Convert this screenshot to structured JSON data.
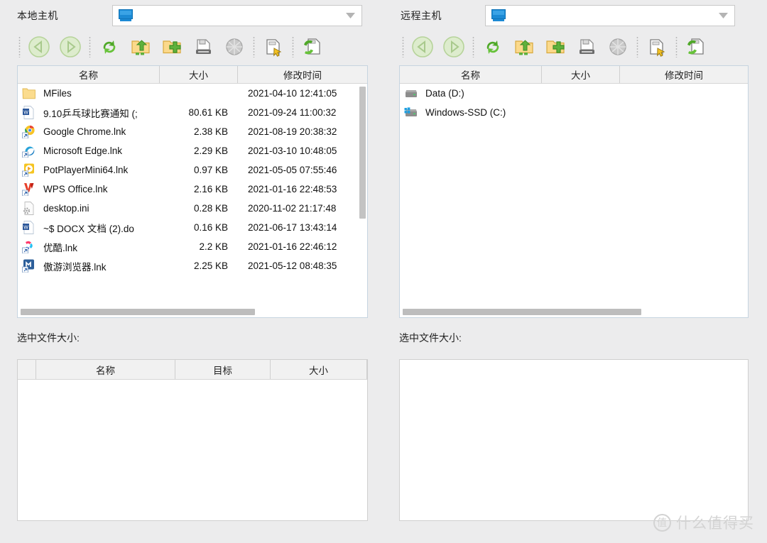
{
  "local": {
    "host_label": "本地主机",
    "combo_value": "",
    "combo_icon": "monitor-icon",
    "columns": {
      "name": "名称",
      "size": "大小",
      "time": "修改时间"
    },
    "files": [
      {
        "icon": "folder-icon",
        "name": "MFiles",
        "size": "",
        "time": "2021-04-10 12:41:05"
      },
      {
        "icon": "word-doc-icon",
        "name": "9.10乒乓球比赛通知 (;",
        "size": "80.61 KB",
        "time": "2021-09-24 11:00:32"
      },
      {
        "icon": "chrome-icon",
        "name": "Google Chrome.lnk",
        "size": "2.38 KB",
        "time": "2021-08-19 20:38:32"
      },
      {
        "icon": "edge-icon",
        "name": "Microsoft Edge.lnk",
        "size": "2.29 KB",
        "time": "2021-03-10 10:48:05"
      },
      {
        "icon": "potplayer-icon",
        "name": "PotPlayerMini64.lnk",
        "size": "0.97 KB",
        "time": "2021-05-05 07:55:46"
      },
      {
        "icon": "wps-icon",
        "name": "WPS Office.lnk",
        "size": "2.16 KB",
        "time": "2021-01-16 22:48:53"
      },
      {
        "icon": "ini-file-icon",
        "name": "desktop.ini",
        "size": "0.28 KB",
        "time": "2020-11-02 21:17:48"
      },
      {
        "icon": "word-doc-icon",
        "name": "~$ DOCX 文档 (2).do",
        "size": "0.16 KB",
        "time": "2021-06-17 13:43:14"
      },
      {
        "icon": "youku-icon",
        "name": "优酷.lnk",
        "size": "2.2 KB",
        "time": "2021-01-16 22:46:12"
      },
      {
        "icon": "maxthon-icon",
        "name": "傲游浏览器.lnk",
        "size": "2.25 KB",
        "time": "2021-05-12 08:48:35"
      }
    ],
    "selected_size_label": "选中文件大小:",
    "queue_columns": {
      "name": "名称",
      "target": "目标",
      "size": "大小"
    }
  },
  "remote": {
    "host_label": "远程主机",
    "combo_value": "",
    "combo_icon": "monitor-icon",
    "columns": {
      "name": "名称",
      "size": "大小",
      "time": "修改时间"
    },
    "files": [
      {
        "icon": "drive-icon",
        "name": "Data (D:)",
        "size": "",
        "time": ""
      },
      {
        "icon": "windows-drive-icon",
        "name": "Windows-SSD (C:)",
        "size": "",
        "time": ""
      }
    ],
    "selected_size_label": "选中文件大小:"
  },
  "toolbar": {
    "buttons": [
      {
        "name": "back-button",
        "icon": "back-arrow-icon",
        "enabled": false
      },
      {
        "name": "forward-button",
        "icon": "forward-arrow-icon",
        "enabled": false
      },
      {
        "name": "refresh-button",
        "icon": "refresh-icon",
        "enabled": true
      },
      {
        "name": "parent-dir-button",
        "icon": "folder-up-icon",
        "enabled": true
      },
      {
        "name": "new-folder-button",
        "icon": "folder-add-icon",
        "enabled": true
      },
      {
        "name": "save-button",
        "icon": "floppy-save-icon",
        "enabled": true
      },
      {
        "name": "globe-button",
        "icon": "globe-icon",
        "enabled": false
      },
      {
        "name": "select-file-button",
        "icon": "file-cursor-icon",
        "enabled": true
      },
      {
        "name": "transfer-button",
        "icon": "file-transfer-icon",
        "enabled": true
      }
    ]
  },
  "watermark": {
    "badge": "值",
    "text": "什么值得买"
  },
  "colors": {
    "background": "#ececed",
    "panel": "#ffffff",
    "header": "#f1f1f1",
    "accent_blue": "#1c8ad4",
    "icon_green": "#5fb13c",
    "scrollbar": "#c3c3c3"
  }
}
